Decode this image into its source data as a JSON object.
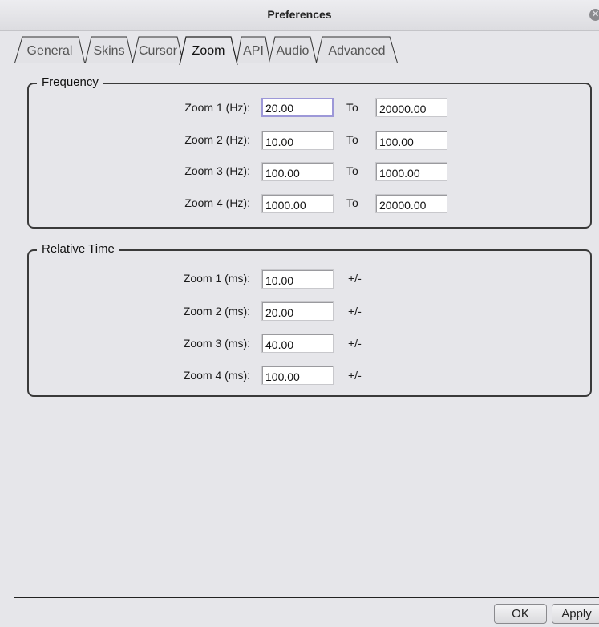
{
  "window": {
    "title": "Preferences"
  },
  "tabs": [
    {
      "label": "General"
    },
    {
      "label": "Skins"
    },
    {
      "label": "Cursor"
    },
    {
      "label": "Zoom",
      "active": true
    },
    {
      "label": "API"
    },
    {
      "label": "Audio"
    },
    {
      "label": "Advanced"
    }
  ],
  "frequency": {
    "title": "Frequency",
    "to_label": "To",
    "rows": [
      {
        "label": "Zoom 1 (Hz):",
        "from": "20.00",
        "to": "20000.00"
      },
      {
        "label": "Zoom 2 (Hz):",
        "from": "10.00",
        "to": "100.00"
      },
      {
        "label": "Zoom 3 (Hz):",
        "from": "100.00",
        "to": "1000.00"
      },
      {
        "label": "Zoom 4 (Hz):",
        "from": "1000.00",
        "to": "20000.00"
      }
    ]
  },
  "relative_time": {
    "title": "Relative Time",
    "suffix": "+/-",
    "rows": [
      {
        "label": "Zoom 1 (ms):",
        "value": "10.00"
      },
      {
        "label": "Zoom 2 (ms):",
        "value": "20.00"
      },
      {
        "label": "Zoom 3 (ms):",
        "value": "40.00"
      },
      {
        "label": "Zoom 4 (ms):",
        "value": "100.00"
      }
    ]
  },
  "buttons": {
    "ok": "OK",
    "apply": "Apply"
  }
}
